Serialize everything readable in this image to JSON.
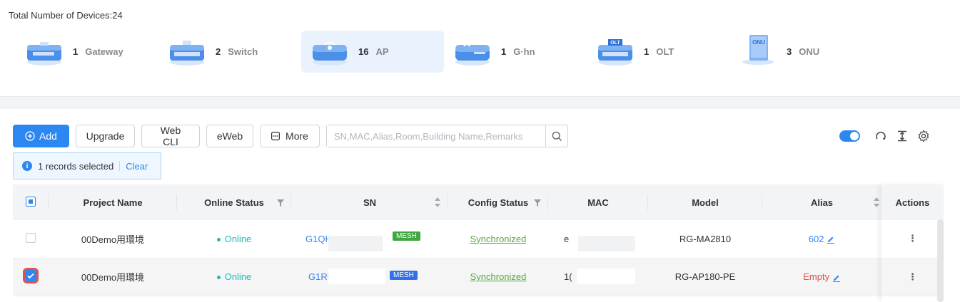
{
  "summary": {
    "total_label": "Total Number of Devices:24",
    "devices": [
      {
        "count": "1",
        "name": "Gateway",
        "icon": "gateway-icon",
        "active": false
      },
      {
        "count": "2",
        "name": "Switch",
        "icon": "switch-icon",
        "active": false
      },
      {
        "count": "16",
        "name": "AP",
        "icon": "ap-icon",
        "active": true
      },
      {
        "count": "1",
        "name": "G·hn",
        "icon": "ghn-icon",
        "active": false
      },
      {
        "count": "1",
        "name": "OLT",
        "icon": "olt-icon",
        "active": false
      },
      {
        "count": "3",
        "name": "ONU",
        "icon": "onu-icon",
        "active": false
      }
    ],
    "icon_labels": {
      "olt": "OLT",
      "onu": "ONU"
    }
  },
  "toolbar": {
    "add_label": "Add",
    "upgrade_label": "Upgrade",
    "webcli_label": "Web CLI",
    "eweb_label": "eWeb",
    "more_label": "More",
    "search_placeholder": "SN,MAC,Alias,Room,Building Name,Remarks"
  },
  "selection": {
    "text": "1 records selected",
    "clear_label": "Clear"
  },
  "table": {
    "headers": {
      "project": "Project Name",
      "online": "Online Status",
      "sn": "SN",
      "config": "Config Status",
      "mac": "MAC",
      "model": "Model",
      "alias": "Alias",
      "actions": "Actions"
    },
    "rows": [
      {
        "project": "00Demo用環境",
        "online": "Online",
        "sn": "G1QH",
        "mesh": "MESH",
        "config": "Synchronized",
        "mac": "e",
        "model": "RG-MA2810",
        "alias": "602",
        "selected": false
      },
      {
        "project": "00Demo用環境",
        "online": "Online",
        "sn": "G1RU",
        "mesh": "MESH",
        "config": "Synchronized",
        "mac": "1(",
        "model": "RG-AP180-PE",
        "alias": "Empty",
        "selected": true
      }
    ]
  },
  "colors": {
    "accent": "#2d87f0",
    "online": "#1cbbb4",
    "synced": "#5aa83e",
    "empty_alias": "#e05050"
  }
}
